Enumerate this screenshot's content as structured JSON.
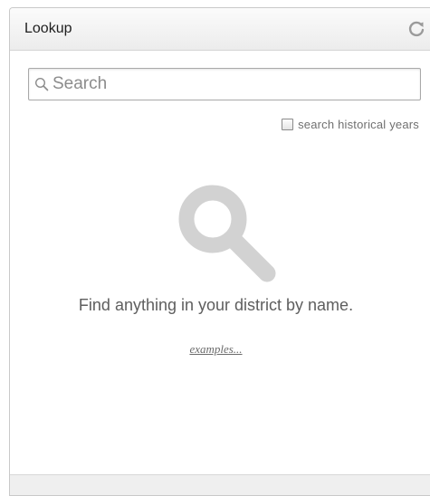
{
  "panel": {
    "title": "Lookup",
    "refresh_icon": "refresh-icon"
  },
  "search": {
    "placeholder": "Search",
    "value": "",
    "icon": "search-icon"
  },
  "historical": {
    "label": "search historical years",
    "checked": false
  },
  "empty_state": {
    "icon": "magnifier-icon",
    "message": "Find anything in your district by name.",
    "examples_link": "examples..."
  },
  "colors": {
    "icon_gray": "#d2d2d2",
    "text_gray": "#5e5e5e",
    "header_bg": "#f2f2f2"
  }
}
